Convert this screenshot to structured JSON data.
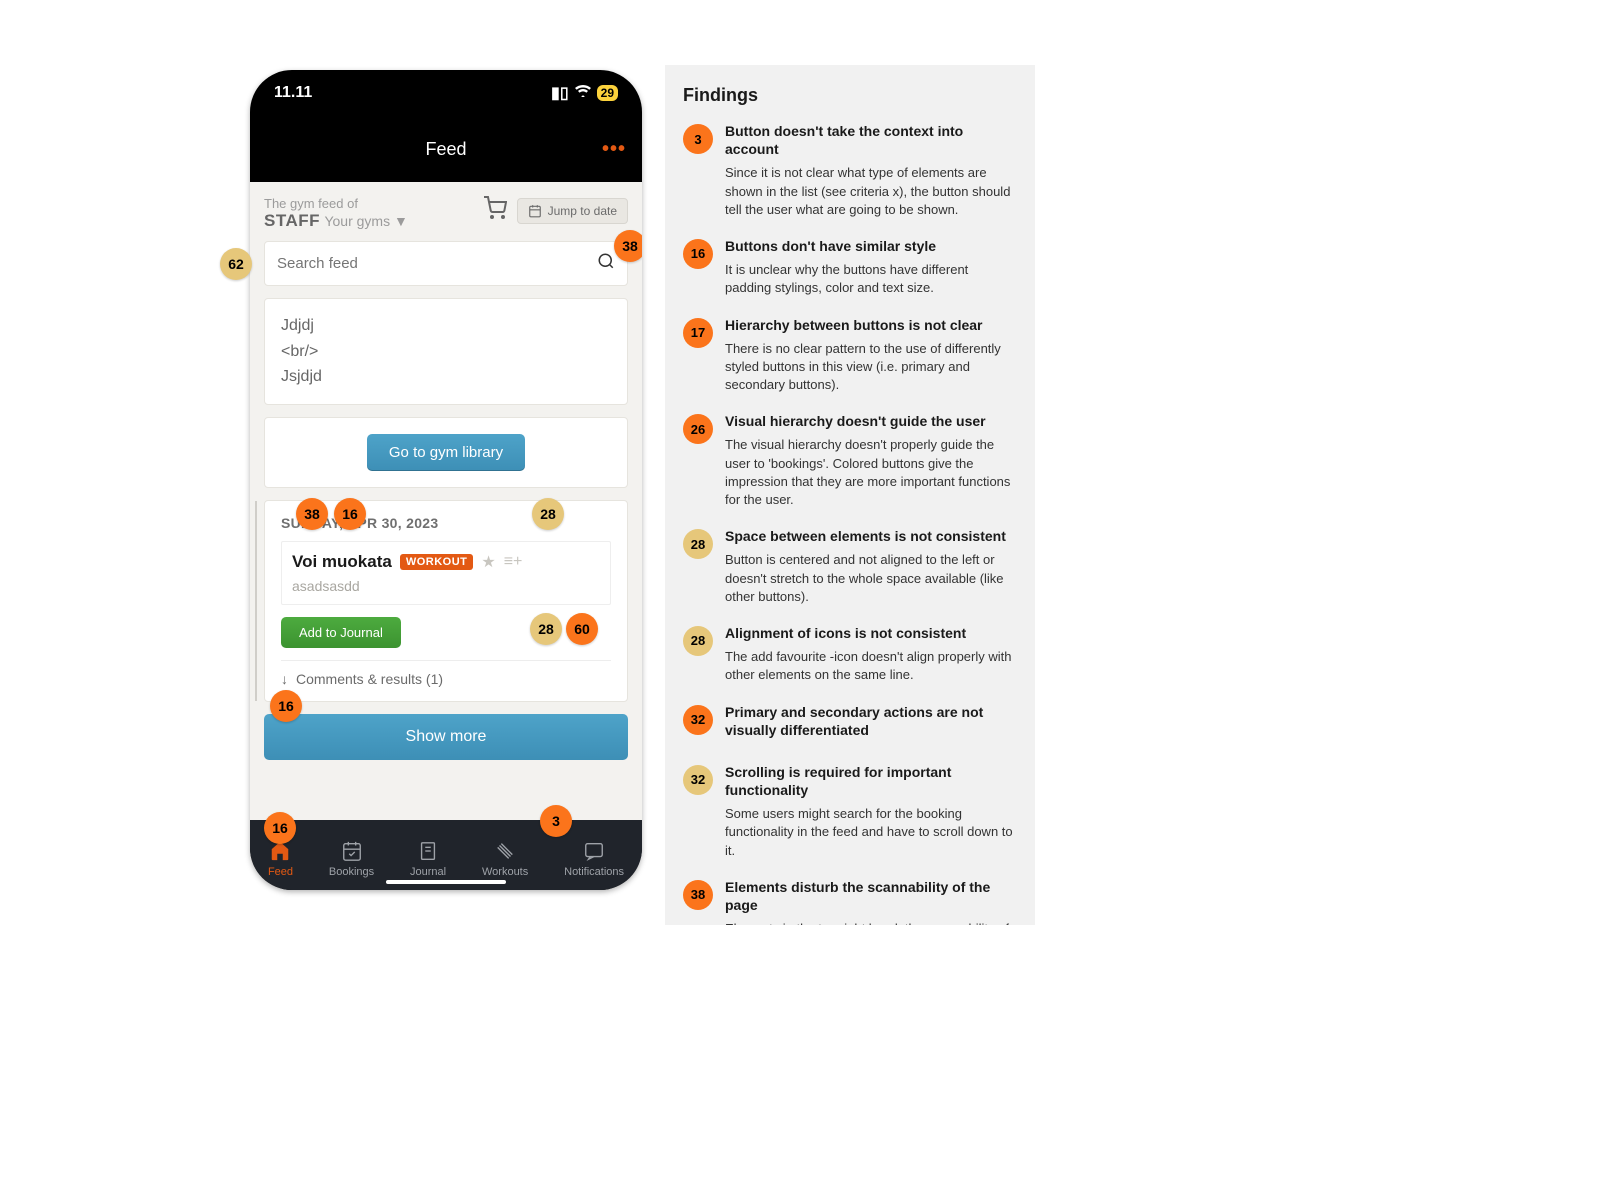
{
  "status": {
    "time": "11.11",
    "battery": "29"
  },
  "header": {
    "title": "Feed",
    "ellipsis": "•••"
  },
  "gymHeader": {
    "sub": "The gym feed of",
    "name": "STAFF",
    "yourGyms": "Your gyms ▼",
    "jumpLabel": "Jump to date"
  },
  "search": {
    "placeholder": "Search feed"
  },
  "note": {
    "line1": "Jdjdj",
    "line2": "<br/>",
    "line3": "Jsjdjd"
  },
  "library": {
    "button": "Go to gym library"
  },
  "workout": {
    "date": "SUNDAY, APR 30, 2023",
    "title": "Voi muokata",
    "badge": "WORKOUT",
    "sub": "asadsasdd",
    "addJournal": "Add to Journal",
    "comments": "Comments & results (1)"
  },
  "showMore": "Show more",
  "tabs": [
    {
      "label": "Feed",
      "active": true
    },
    {
      "label": "Bookings",
      "active": false
    },
    {
      "label": "Journal",
      "active": false
    },
    {
      "label": "Workouts",
      "active": false
    },
    {
      "label": "Notifications",
      "active": false
    }
  ],
  "pins": [
    {
      "num": "62",
      "color": "tan"
    },
    {
      "num": "38",
      "color": "orange"
    },
    {
      "num": "38",
      "color": "orange"
    },
    {
      "num": "16",
      "color": "orange"
    },
    {
      "num": "28",
      "color": "tan"
    },
    {
      "num": "28",
      "color": "tan"
    },
    {
      "num": "60",
      "color": "orange"
    },
    {
      "num": "16",
      "color": "orange"
    },
    {
      "num": "16",
      "color": "orange"
    },
    {
      "num": "3",
      "color": "orange"
    }
  ],
  "findingsHeading": "Findings",
  "findings": [
    {
      "num": "3",
      "color": "orange",
      "title": "Button doesn't take the context into account",
      "desc": "Since it is not clear what type of elements are shown in the list (see criteria x), the button should tell the user what are going to be shown."
    },
    {
      "num": "16",
      "color": "orange",
      "title": "Buttons don't have similar style",
      "desc": "It is unclear why the buttons have different padding stylings, color and text size."
    },
    {
      "num": "17",
      "color": "orange",
      "title": "Hierarchy between buttons is not clear",
      "desc": "There is no clear pattern to the use of differently styled buttons in this view (i.e. primary and secondary buttons)."
    },
    {
      "num": "26",
      "color": "orange",
      "title": "Visual hierarchy doesn't guide the user",
      "desc": "The visual hierarchy doesn't properly guide the user to 'bookings'. Colored buttons give the impression that they are more important functions for the user."
    },
    {
      "num": "28",
      "color": "tan",
      "title": "Space between elements is not consistent",
      "desc": "Button is centered and not aligned to the left or doesn't stretch to the whole space available (like other buttons)."
    },
    {
      "num": "28",
      "color": "tan",
      "title": "Alignment of icons is not consistent",
      "desc": "The add favourite -icon doesn't align properly with other elements on the same line."
    },
    {
      "num": "32",
      "color": "orange",
      "title": "Primary and secondary actions are not visually differentiated",
      "desc": ""
    },
    {
      "num": "32",
      "color": "tan",
      "title": "Scrolling is required for important functionality",
      "desc": "Some users might search for the booking functionality in the feed and have to scroll down to it."
    },
    {
      "num": "38",
      "color": "orange",
      "title": "Elements disturb the scannability of the page",
      "desc": "Elements in the top right break the scannability of relevant information."
    }
  ]
}
